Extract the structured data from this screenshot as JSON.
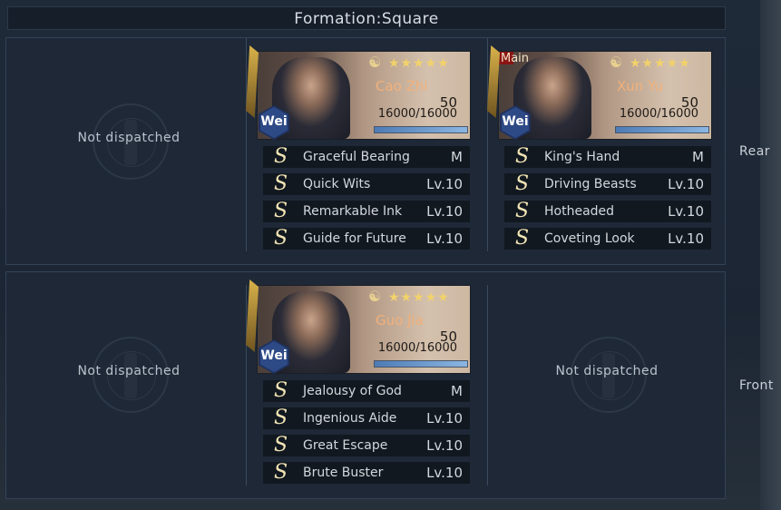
{
  "header": {
    "title": "Formation:Square"
  },
  "rows": [
    {
      "label": "Rear"
    },
    {
      "label": "Front"
    }
  ],
  "empty_label": "Not dispatched",
  "generals": [
    {
      "name": "Cao Zhi",
      "faction": "Wei",
      "level": "50",
      "hp": "16000/16000",
      "stars": "★★★★★",
      "star_count": 5,
      "hp_fraction": 1.0,
      "main": false,
      "skills": [
        {
          "name": "Graceful Bearing",
          "level": "M"
        },
        {
          "name": "Quick Wits",
          "level": "Lv.10"
        },
        {
          "name": "Remarkable Ink",
          "level": "Lv.10"
        },
        {
          "name": "Guide for Future",
          "level": "Lv.10"
        }
      ]
    },
    {
      "name": "Xun Yu",
      "faction": "Wei",
      "level": "50",
      "hp": "16000/16000",
      "stars": "★★★★★",
      "star_count": 5,
      "hp_fraction": 1.0,
      "main": true,
      "main_label": "Main",
      "skills": [
        {
          "name": "King's Hand",
          "level": "M"
        },
        {
          "name": "Driving Beasts",
          "level": "Lv.10"
        },
        {
          "name": "Hotheaded",
          "level": "Lv.10"
        },
        {
          "name": "Coveting Look",
          "level": "Lv.10"
        }
      ]
    },
    {
      "name": "Guo Jia",
      "faction": "Wei",
      "level": "50",
      "hp": "16000/16000",
      "stars": "★★★★★",
      "star_count": 5,
      "hp_fraction": 1.0,
      "main": false,
      "skills": [
        {
          "name": "Jealousy of God",
          "level": "M"
        },
        {
          "name": "Ingenious Aide",
          "level": "Lv.10"
        },
        {
          "name": "Great Escape",
          "level": "Lv.10"
        },
        {
          "name": "Brute Buster",
          "level": "Lv.10"
        }
      ]
    }
  ],
  "skill_glyph": "S",
  "icons": {
    "skill": "skill-s-icon",
    "faction": "faction-hex-icon",
    "emblem": "empty-slot-emblem-icon"
  }
}
